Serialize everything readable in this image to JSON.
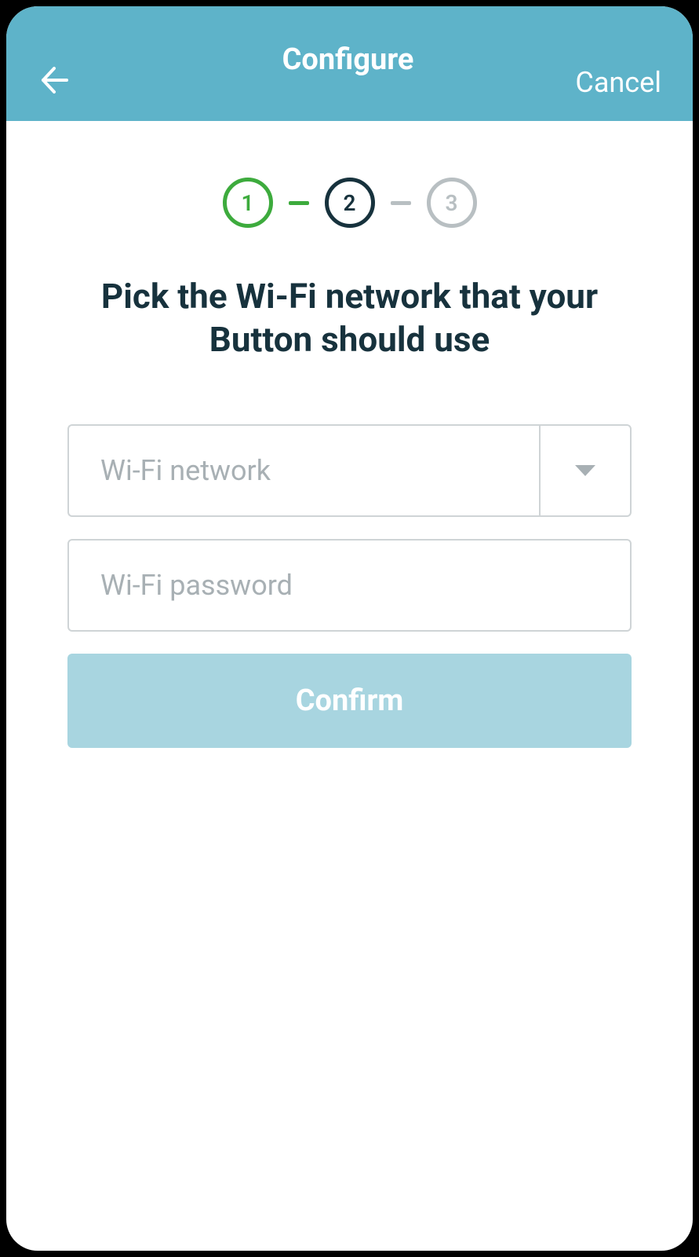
{
  "header": {
    "title": "Configure",
    "cancel_label": "Cancel"
  },
  "stepper": {
    "steps": [
      "1",
      "2",
      "3"
    ],
    "current": 2
  },
  "page": {
    "title": "Pick the Wi-Fi network that your Button should use"
  },
  "form": {
    "network_placeholder": "Wi-Fi network",
    "network_value": "",
    "password_placeholder": "Wi-Fi password",
    "password_value": "",
    "confirm_label": "Confirm"
  }
}
